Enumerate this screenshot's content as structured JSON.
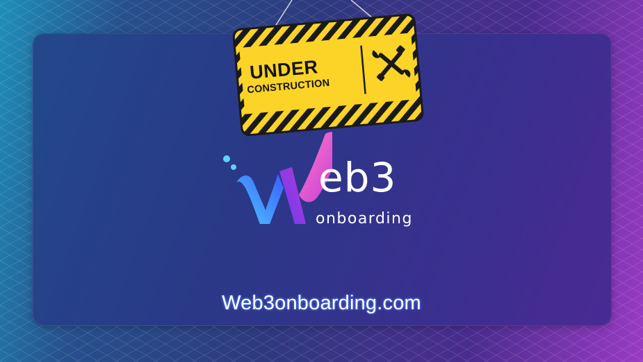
{
  "sign": {
    "title": "UNDER",
    "subtitle": "CONSTRUCTION",
    "icon": "wrench-screwdriver-icon",
    "colors": {
      "yellow": "#fbd427",
      "stripe": "#1a1a1a"
    }
  },
  "logo": {
    "mark_letter": "W",
    "wordmark": "eb3",
    "tagline": "onboarding",
    "colors": {
      "blue": "#3a6bff",
      "purple": "#8b3fe0",
      "pink": "#ff3fa0",
      "cyan": "#5fd0ff"
    }
  },
  "footer": {
    "site_url": "Web3onboarding.com"
  },
  "theme": {
    "background_left": "#1f8fb8",
    "background_right": "#9a3bc4",
    "card": "#2a3887"
  }
}
